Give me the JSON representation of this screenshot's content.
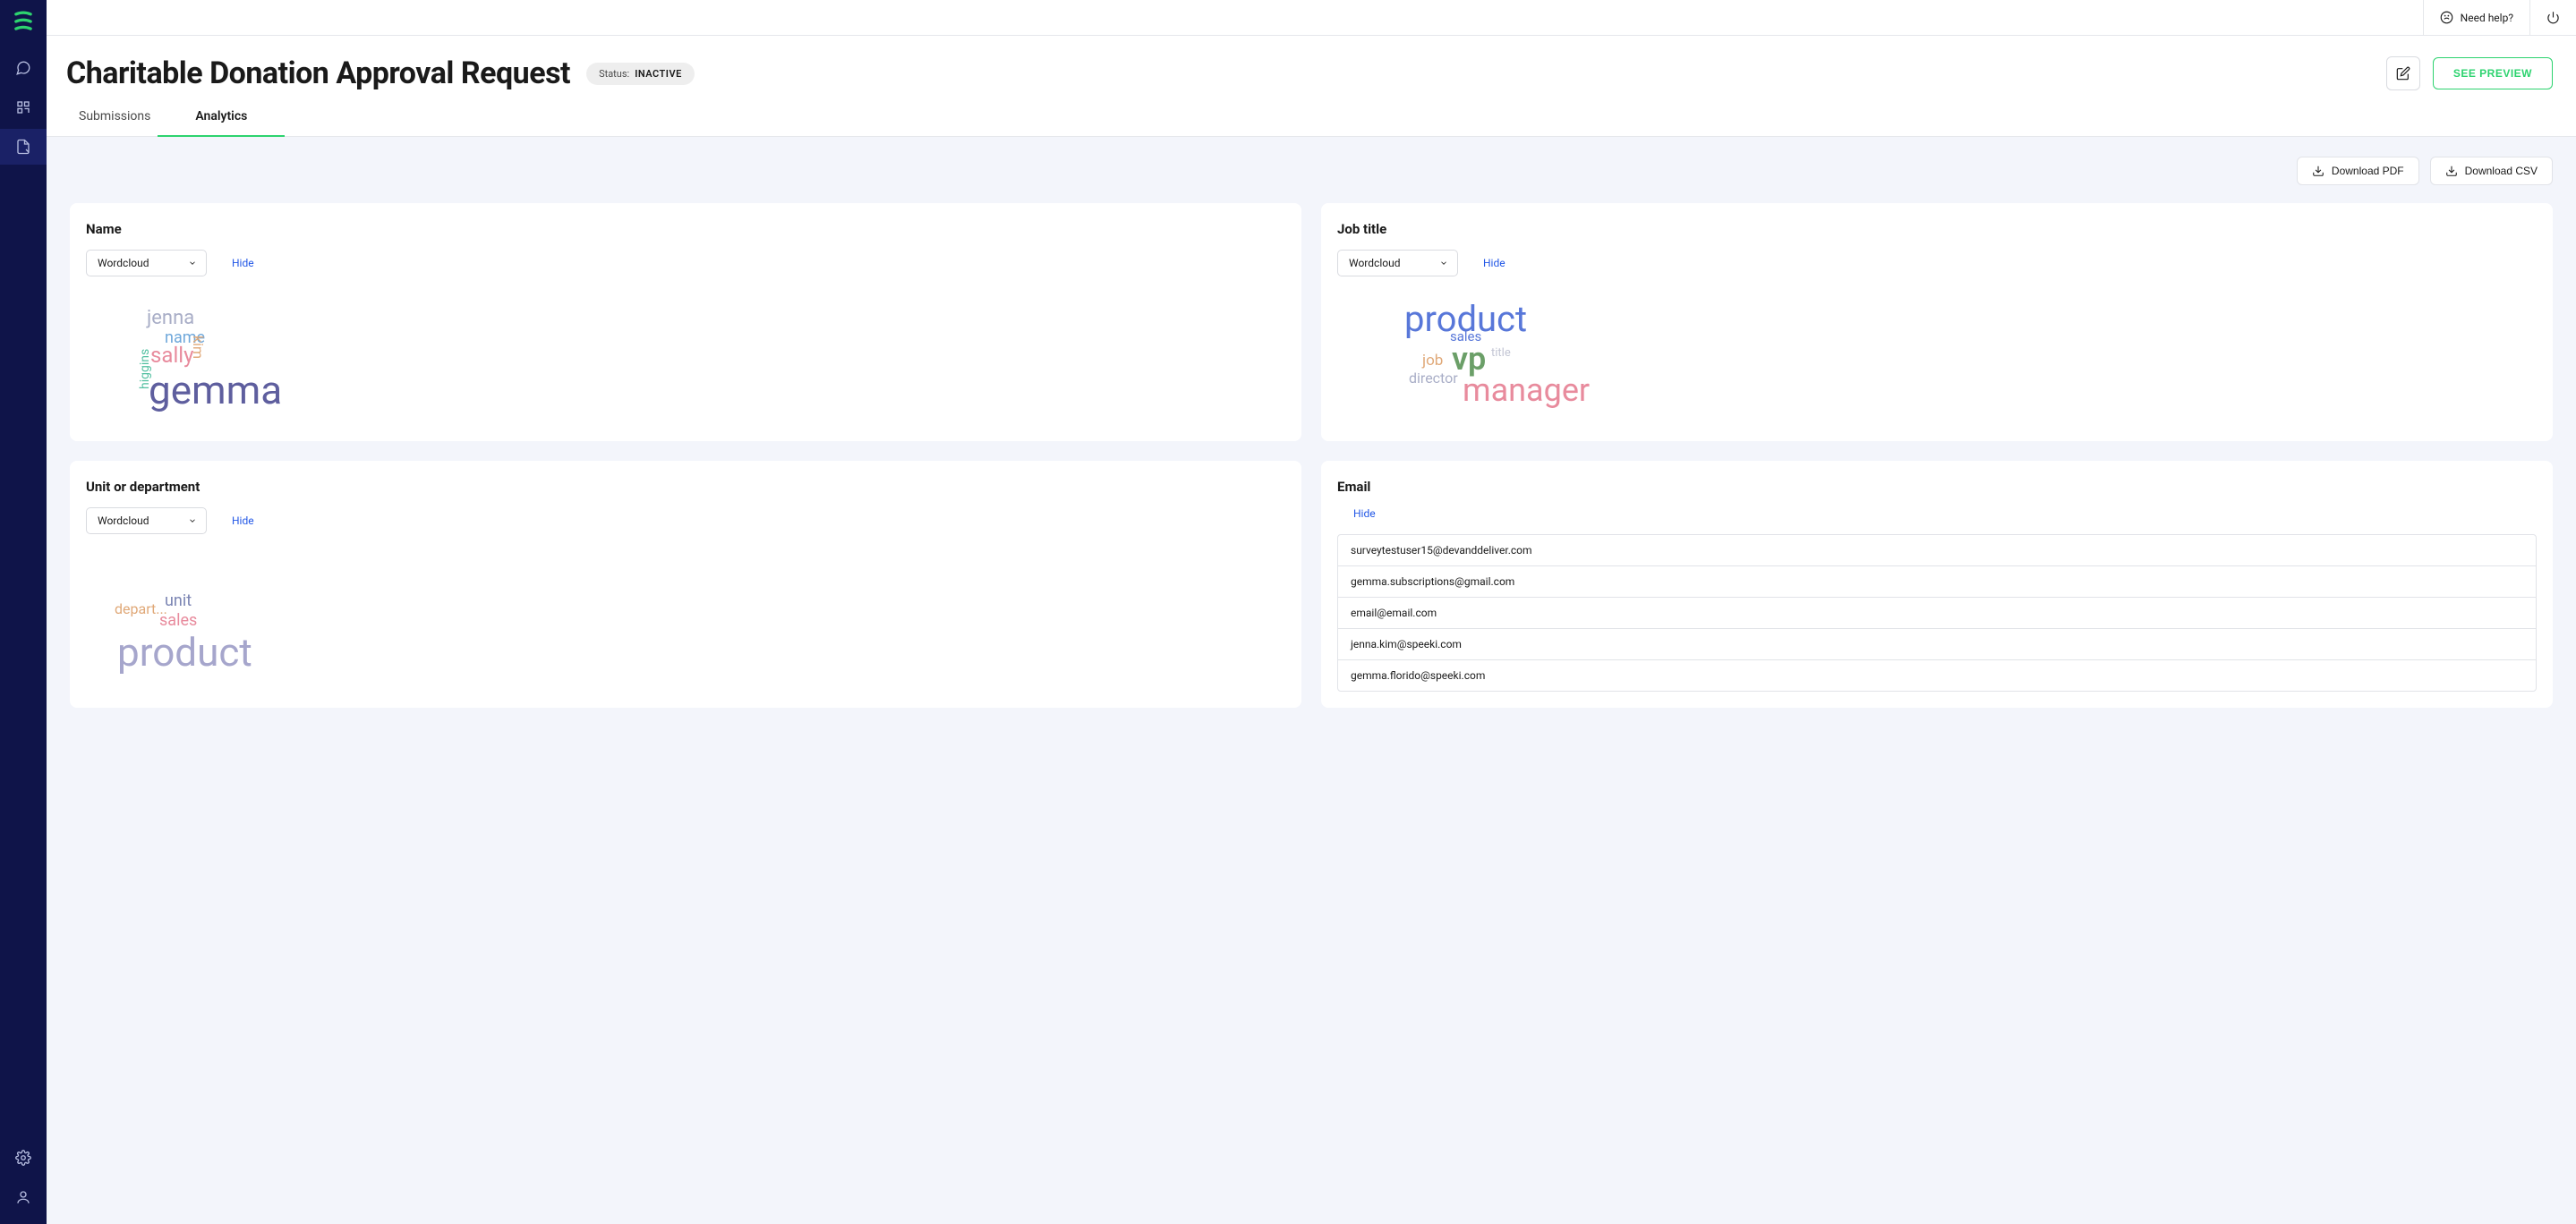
{
  "topbar": {
    "help_label": "Need help?"
  },
  "header": {
    "title": "Charitable Donation Approval Request",
    "status_label": "Status:",
    "status_value": "INACTIVE",
    "preview_button": "SEE PREVIEW"
  },
  "tabs": {
    "submissions": "Submissions",
    "analytics": "Analytics"
  },
  "downloads": {
    "pdf": "Download PDF",
    "csv": "Download CSV"
  },
  "cards": {
    "name": {
      "title": "Name",
      "select": "Wordcloud",
      "hide": "Hide",
      "words": {
        "gemma": "gemma",
        "sally": "sally",
        "jenna": "jenna",
        "name": "name",
        "kim": "kim",
        "higgins": "higgins"
      }
    },
    "jobtitle": {
      "title": "Job title",
      "select": "Wordcloud",
      "hide": "Hide",
      "words": {
        "product": "product",
        "manager": "manager",
        "vp": "vp",
        "sales": "sales",
        "job": "job",
        "director": "director",
        "title": "title"
      }
    },
    "unit": {
      "title": "Unit or department",
      "select": "Wordcloud",
      "hide": "Hide",
      "words": {
        "product": "product",
        "unit": "unit",
        "sales": "sales",
        "depart": "depart..."
      }
    },
    "email": {
      "title": "Email",
      "hide": "Hide",
      "rows": [
        "surveytestuser15@devanddeliver.com",
        "gemma.subscriptions@gmail.com",
        "email@email.com",
        "jenna.kim@speeki.com",
        "gemma.florido@speeki.com"
      ]
    }
  }
}
